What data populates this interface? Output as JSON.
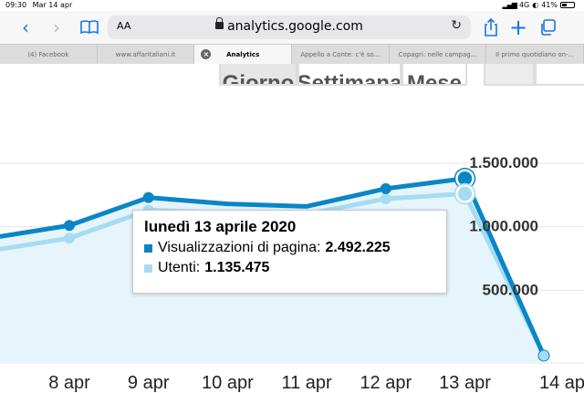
{
  "status": {
    "time": "09:30",
    "date": "Mar 14 apr",
    "network": "4G",
    "battery": "41%"
  },
  "toolbar": {
    "text_size_label": "AA",
    "url": "analytics.google.com",
    "icons": [
      "back-icon",
      "forward-icon",
      "bookmarks-icon",
      "share-icon",
      "new-tab-icon",
      "tabs-icon",
      "reload-icon",
      "lock-icon"
    ]
  },
  "tabs": [
    {
      "label": "(4) Facebook"
    },
    {
      "label": "www.affaritaliani.it"
    },
    {
      "label": "Analytics",
      "active": true
    },
    {
      "label": "Appello a Conte: c'è so..."
    },
    {
      "label": "Copagri: nelle campag..."
    },
    {
      "label": "Il primo quotidiano on-..."
    }
  ],
  "segments": [
    {
      "label": "Giorno",
      "active": true
    },
    {
      "label": "Settimana"
    },
    {
      "label": "Mese"
    }
  ],
  "colors": {
    "pageviews": "#0a86c6",
    "users": "#a6dcf2",
    "fill": "#e6f4fb",
    "grid": "#e4e4e4"
  },
  "chart_data": {
    "type": "line",
    "categories": [
      "8 apr",
      "9 apr",
      "10 apr",
      "11 apr",
      "12 apr",
      "13 apr",
      "14 ap"
    ],
    "y_ticks": [
      {
        "value": 1500000,
        "label": "1.500.000"
      },
      {
        "value": 1000000,
        "label": "1.000.000"
      },
      {
        "value": 500000,
        "label": "500.000"
      }
    ],
    "series": [
      {
        "name": "Visualizzazioni di pagina",
        "values": [
          1010000,
          1230000,
          1180000,
          1160000,
          1300000,
          1380000,
          60000
        ]
      },
      {
        "name": "Utenti",
        "values": [
          910000,
          1130000,
          1110000,
          1100000,
          1220000,
          1260000,
          60000
        ]
      }
    ],
    "grid": true
  },
  "tooltip": {
    "title": "lunedì 13 aprile 2020",
    "rows": [
      {
        "label": "Visualizzazioni di pagina:",
        "value": "2.492.225"
      },
      {
        "label": "Utenti:",
        "value": "1.135.475"
      }
    ]
  }
}
